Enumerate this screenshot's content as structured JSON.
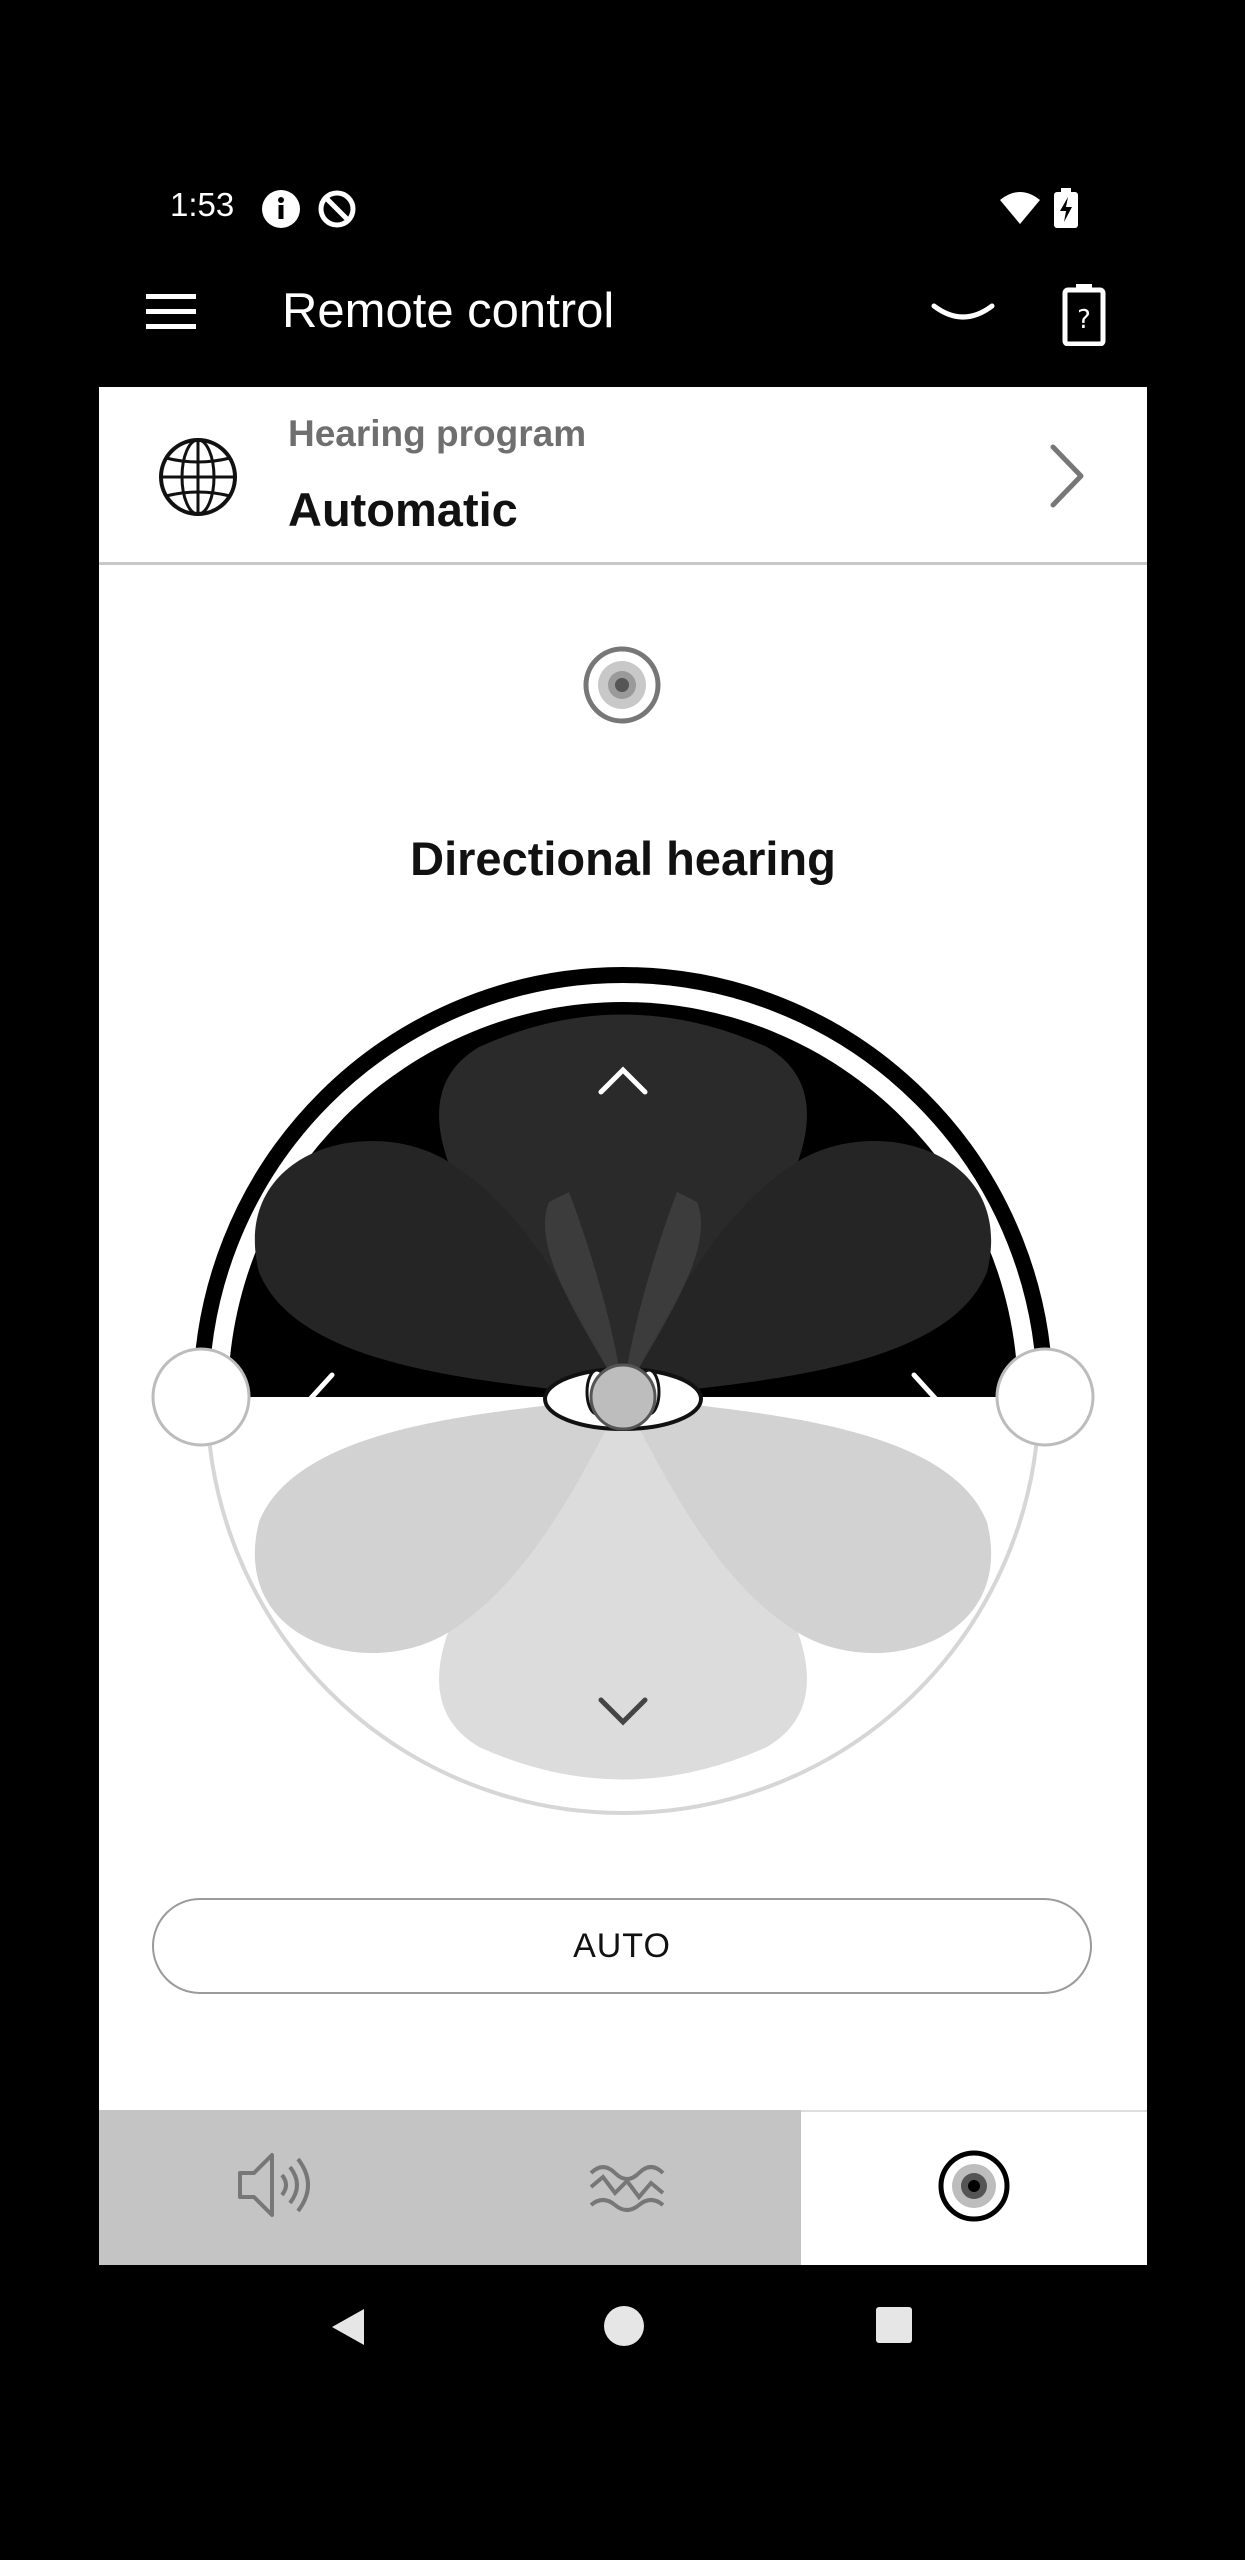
{
  "status_bar": {
    "time": "1:53",
    "icons": [
      "info-icon",
      "no-sync-icon",
      "wifi-icon",
      "battery-charging-icon"
    ]
  },
  "app_bar": {
    "title": "Remote control",
    "icons": [
      "menu-icon",
      "collapse-chevron-icon",
      "hearing-aid-battery-icon"
    ]
  },
  "hearing_program": {
    "label": "Hearing program",
    "value": "Automatic",
    "icon": "globe-icon"
  },
  "directional": {
    "mode_icon": "directional-target-icon",
    "title": "Directional hearing",
    "controls": [
      "up-arrow",
      "left-arrow",
      "right-arrow",
      "down-arrow"
    ],
    "auto_button_label": "AUTO"
  },
  "bottom_tabs": [
    {
      "name": "volume",
      "icon": "speaker-icon",
      "selected": false
    },
    {
      "name": "sound",
      "icon": "waves-icon",
      "selected": false
    },
    {
      "name": "directional",
      "icon": "target-icon",
      "selected": true
    }
  ],
  "nav_bar": [
    "back-icon",
    "home-icon",
    "recents-icon"
  ],
  "colors": {
    "background": "#000000",
    "card": "#ffffff",
    "front_zone": "#1e1e1e",
    "rear_zone": "#d9d9d9",
    "tab_inactive": "#c4c4c4"
  }
}
